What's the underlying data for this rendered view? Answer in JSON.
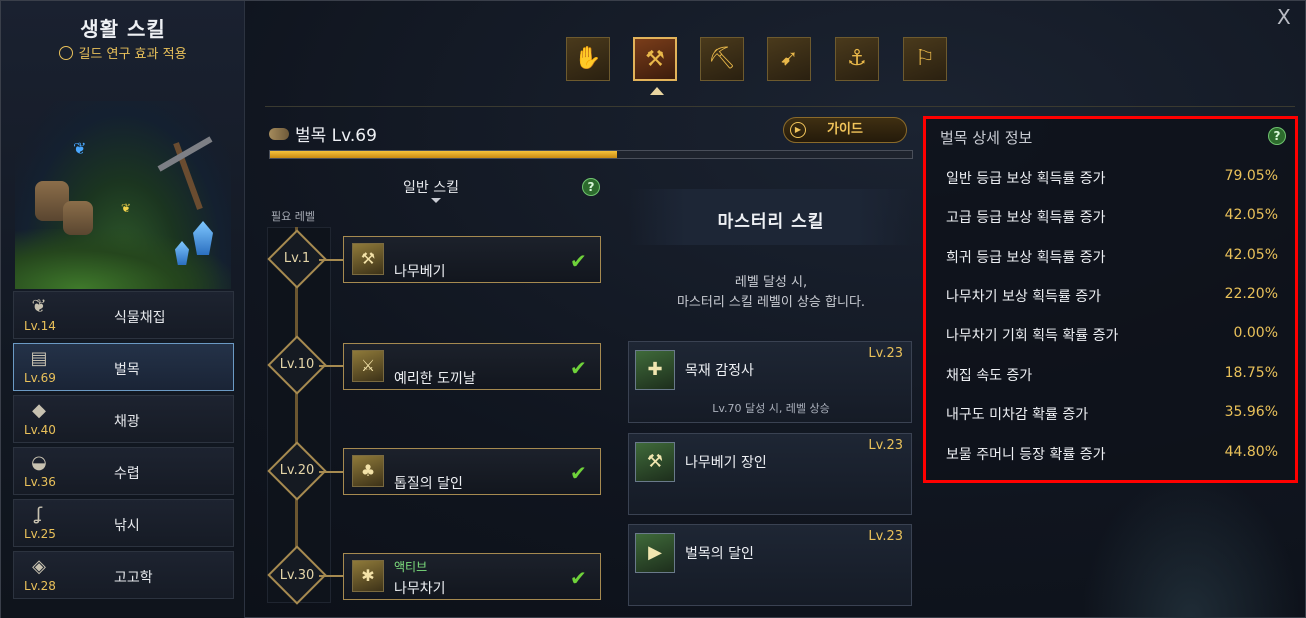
{
  "window": {
    "title": "생활 스킬",
    "subtitle": "길드 연구 효과 적용",
    "close_label": "X"
  },
  "categories": [
    {
      "name": "식물채집",
      "level": "Lv.14",
      "icon": "sprout-icon",
      "glyph": "❦",
      "active": false
    },
    {
      "name": "벌목",
      "level": "Lv.69",
      "icon": "log-icon",
      "glyph": "▤",
      "active": true
    },
    {
      "name": "채광",
      "level": "Lv.40",
      "icon": "ore-icon",
      "glyph": "◆",
      "active": false
    },
    {
      "name": "수렵",
      "level": "Lv.36",
      "icon": "trap-icon",
      "glyph": "◒",
      "active": false
    },
    {
      "name": "낚시",
      "level": "Lv.25",
      "icon": "hook-icon",
      "glyph": "ʆ",
      "active": false
    },
    {
      "name": "고고학",
      "level": "Lv.28",
      "icon": "relic-icon",
      "glyph": "◈",
      "active": false
    }
  ],
  "tools": [
    {
      "name": "gathering-tool-icon",
      "glyph": "✋",
      "active": false
    },
    {
      "name": "logging-tool-icon",
      "glyph": "⚒",
      "active": true
    },
    {
      "name": "mining-tool-icon",
      "glyph": "⛏",
      "active": false
    },
    {
      "name": "hunting-tool-icon",
      "glyph": "➹",
      "active": false
    },
    {
      "name": "fishing-tool-icon",
      "glyph": "⚓",
      "active": false
    },
    {
      "name": "excavating-tool-icon",
      "glyph": "⚐",
      "active": false
    }
  ],
  "skill": {
    "name": "벌목 Lv.69",
    "guide_label": "가이드",
    "exp_progress": 0.54
  },
  "normal": {
    "header": "일반 스킬",
    "help": "?",
    "required_level_label": "필요 레벨",
    "skills": [
      {
        "level": "Lv.1",
        "name": "나무베기",
        "tag": "",
        "icon": "chop-icon",
        "glyph": "⚒",
        "check": "✔"
      },
      {
        "level": "Lv.10",
        "name": "예리한 도끼날",
        "tag": "",
        "icon": "axe-blade-icon",
        "glyph": "⚔",
        "check": "✔"
      },
      {
        "level": "Lv.20",
        "name": "톱질의 달인",
        "tag": "",
        "icon": "tree-saw-icon",
        "glyph": "♣",
        "check": "✔"
      },
      {
        "level": "Lv.30",
        "name": "나무차기",
        "tag": "액티브",
        "icon": "kick-tree-icon",
        "glyph": "✱",
        "check": "✔"
      }
    ]
  },
  "mastery": {
    "title": "마스터리 스킬",
    "desc_line1": "레벨 달성 시,",
    "desc_line2": "마스터리 스킬 레벨이 상승 합니다.",
    "skills": [
      {
        "name": "목재 감정사",
        "level": "Lv.23",
        "note": "Lv.70 달성 시, 레벨 상승",
        "icon": "wood-appraiser-icon",
        "glyph": "✚"
      },
      {
        "name": "나무베기 장인",
        "level": "Lv.23",
        "note": "",
        "icon": "chop-master-icon",
        "glyph": "⚒"
      },
      {
        "name": "벌목의 달인",
        "level": "Lv.23",
        "note": "",
        "icon": "logging-master-icon",
        "glyph": "▶"
      }
    ]
  },
  "detail": {
    "title": "벌목 상세 정보",
    "help": "?",
    "stats": [
      {
        "label": "일반 등급 보상 획득률 증가",
        "value": "79.05%"
      },
      {
        "label": "고급 등급 보상 획득률 증가",
        "value": "42.05%"
      },
      {
        "label": "희귀 등급 보상 획득률 증가",
        "value": "42.05%"
      },
      {
        "label": "나무차기 보상 획득률 증가",
        "value": "22.20%"
      },
      {
        "label": "나무차기 기회 획득 확률 증가",
        "value": "0.00%"
      },
      {
        "label": "채집 속도 증가",
        "value": "18.75%"
      },
      {
        "label": "내구도 미차감 확률 증가",
        "value": "35.96%"
      },
      {
        "label": "보물 주머니 등장 확률 증가",
        "value": "44.80%"
      }
    ]
  },
  "colors": {
    "highlight_border": "#ff0000",
    "gold": "#e9c15a",
    "check": "#6fd23a"
  }
}
